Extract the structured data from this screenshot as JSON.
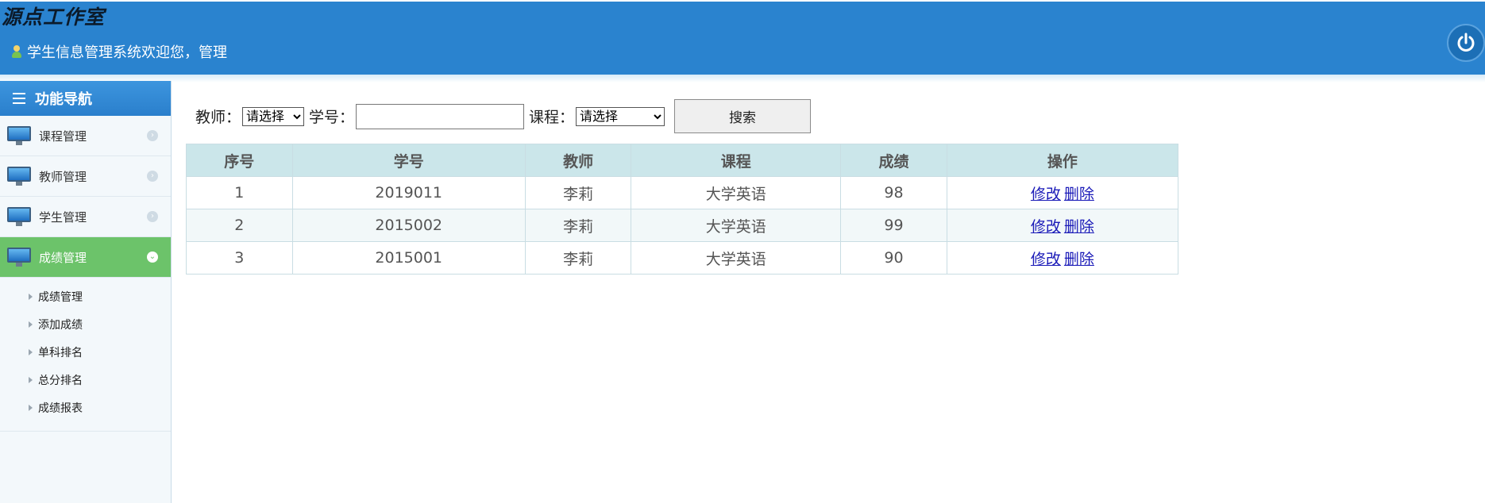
{
  "header": {
    "brand": "源点工作室",
    "welcome": "学生信息管理系统欢迎您，管理",
    "power_icon": "power-icon"
  },
  "sidebar": {
    "title": "功能导航",
    "items": [
      {
        "label": "课程管理",
        "icon": "monitor-icon",
        "active": false
      },
      {
        "label": "教师管理",
        "icon": "monitor-icon",
        "active": false
      },
      {
        "label": "学生管理",
        "icon": "monitor-icon",
        "active": false
      },
      {
        "label": "成绩管理",
        "icon": "monitor-icon",
        "active": true
      }
    ],
    "sub_items": [
      "成绩管理",
      "添加成绩",
      "单科排名",
      "总分排名",
      "成绩报表"
    ]
  },
  "search": {
    "teacher_label": "教师：",
    "teacher_selected": "请选择",
    "student_id_label": "学号：",
    "student_id_value": "",
    "course_label": "课程：",
    "course_selected": "请选择",
    "search_button": "搜索"
  },
  "table": {
    "headers": [
      "序号",
      "学号",
      "教师",
      "课程",
      "成绩",
      "操作"
    ],
    "rows": [
      {
        "no": "1",
        "student_id": "2019011",
        "teacher": "李莉",
        "course": "大学英语",
        "score": "98"
      },
      {
        "no": "2",
        "student_id": "2015002",
        "teacher": "李莉",
        "course": "大学英语",
        "score": "99"
      },
      {
        "no": "3",
        "student_id": "2015001",
        "teacher": "李莉",
        "course": "大学英语",
        "score": "90"
      }
    ],
    "edit_label": "修改",
    "delete_label": "删除"
  },
  "colors": {
    "header_bg": "#2a83cf",
    "active_nav": "#6cc36a",
    "table_header": "#cbe6ea",
    "link": "#1a1ab8"
  }
}
